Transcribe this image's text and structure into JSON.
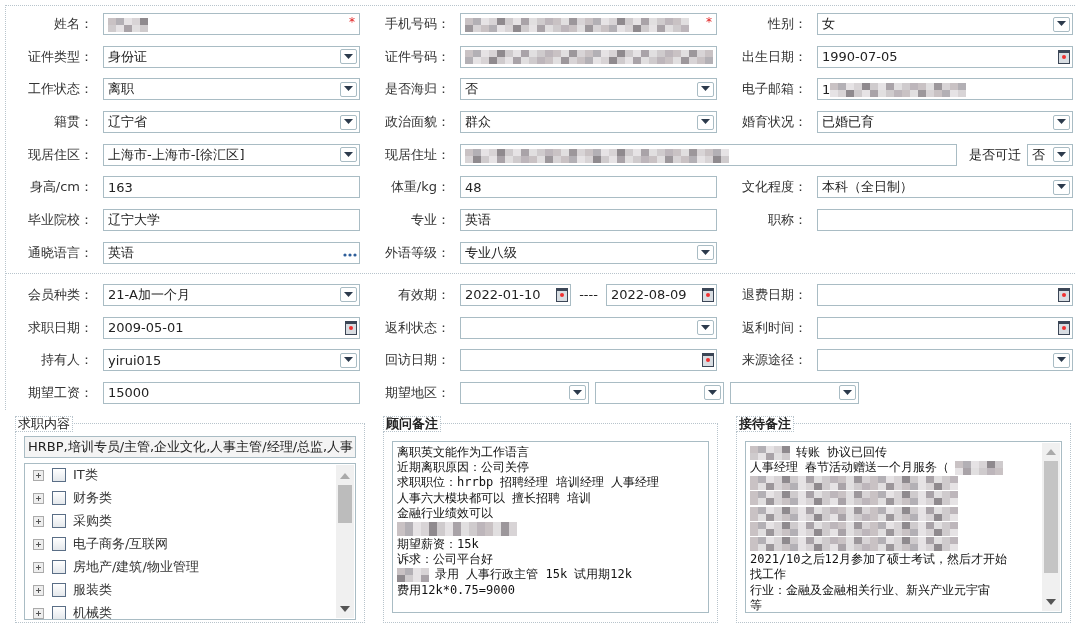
{
  "sections": [
    {
      "rows": [
        [
          {
            "label": "姓名：",
            "parts": [
              {
                "kind": "text",
                "redacted": true,
                "required_mark": "*"
              }
            ]
          },
          {
            "label": "手机号码：",
            "parts": [
              {
                "kind": "text",
                "redacted": true,
                "required_mark": "*"
              }
            ]
          },
          {
            "label": "性别：",
            "parts": [
              {
                "kind": "select",
                "value": "女"
              }
            ]
          }
        ],
        [
          {
            "label": "证件类型：",
            "parts": [
              {
                "kind": "select",
                "value": "身份证"
              }
            ]
          },
          {
            "label": "证件号码：",
            "parts": [
              {
                "kind": "text",
                "redacted": true
              }
            ]
          },
          {
            "label": "出生日期：",
            "parts": [
              {
                "kind": "date",
                "value": "1990-07-05"
              }
            ]
          }
        ],
        [
          {
            "label": "工作状态：",
            "parts": [
              {
                "kind": "select",
                "value": "离职"
              }
            ]
          },
          {
            "label": "是否海归：",
            "parts": [
              {
                "kind": "select",
                "value": "否"
              }
            ]
          },
          {
            "label": "电子邮箱：",
            "parts": [
              {
                "kind": "text",
                "value": "1",
                "redacted": true
              }
            ]
          }
        ],
        [
          {
            "label": "籍贯：",
            "parts": [
              {
                "kind": "select",
                "value": "辽宁省"
              }
            ]
          },
          {
            "label": "政治面貌：",
            "parts": [
              {
                "kind": "select",
                "value": "群众"
              }
            ]
          },
          {
            "label": "婚育状况：",
            "parts": [
              {
                "kind": "select",
                "value": "已婚已育"
              }
            ]
          }
        ],
        [
          {
            "label": "现居住区：",
            "parts": [
              {
                "kind": "select",
                "value": "上海市-上海市-[徐汇区]"
              }
            ]
          },
          {
            "label": "现居住址：",
            "parts": [
              {
                "kind": "text",
                "redacted": true
              },
              {
                "kind": "label",
                "text": "是否可迁"
              },
              {
                "kind": "mini_select",
                "value": "否"
              }
            ]
          }
        ],
        [
          {
            "label": "身高/cm：",
            "parts": [
              {
                "kind": "text",
                "value": "163"
              }
            ]
          },
          {
            "label": "体重/kg：",
            "parts": [
              {
                "kind": "text",
                "value": "48"
              }
            ]
          },
          {
            "label": "文化程度：",
            "parts": [
              {
                "kind": "select",
                "value": "本科（全日制）"
              }
            ]
          }
        ],
        [
          {
            "label": "毕业院校：",
            "parts": [
              {
                "kind": "text",
                "value": "辽宁大学"
              }
            ]
          },
          {
            "label": "专业：",
            "parts": [
              {
                "kind": "text",
                "value": "英语"
              }
            ]
          },
          {
            "label": "职称：",
            "parts": [
              {
                "kind": "text"
              }
            ]
          }
        ],
        [
          {
            "label": "通晓语言：",
            "parts": [
              {
                "kind": "lookup",
                "value": "英语"
              }
            ]
          },
          {
            "label": "外语等级：",
            "parts": [
              {
                "kind": "select",
                "value": "专业八级"
              }
            ]
          },
          null
        ]
      ]
    },
    {
      "rows": [
        [
          {
            "label": "会员种类：",
            "parts": [
              {
                "kind": "select",
                "value": "21-A加一个月"
              }
            ]
          },
          {
            "label": "有效期：",
            "parts": [
              {
                "kind": "date",
                "value": "2022-01-10"
              },
              {
                "kind": "separator",
                "text": "----"
              },
              {
                "kind": "date",
                "value": "2022-08-09"
              }
            ]
          },
          {
            "label": "退费日期：",
            "parts": [
              {
                "kind": "date"
              }
            ]
          }
        ],
        [
          {
            "label": "求职日期：",
            "parts": [
              {
                "kind": "date",
                "value": "2009-05-01"
              }
            ]
          },
          {
            "label": "返利状态：",
            "parts": [
              {
                "kind": "select"
              }
            ]
          },
          {
            "label": "返利时间：",
            "parts": [
              {
                "kind": "date"
              }
            ]
          }
        ],
        [
          {
            "label": "持有人：",
            "parts": [
              {
                "kind": "select",
                "value": "yirui015"
              }
            ]
          },
          {
            "label": "回访日期：",
            "parts": [
              {
                "kind": "date"
              }
            ]
          },
          {
            "label": "来源途径：",
            "parts": [
              {
                "kind": "select"
              }
            ]
          }
        ],
        [
          {
            "label": "期望工资：",
            "parts": [
              {
                "kind": "text",
                "value": "15000"
              }
            ]
          },
          {
            "label": "期望地区：",
            "parts": [
              {
                "kind": "area_select"
              },
              {
                "kind": "area_select"
              },
              {
                "kind": "area_select"
              }
            ]
          }
        ]
      ]
    }
  ],
  "job_intent": {
    "legend": "求职内容",
    "selected_text": "HRBP,培训专员/主管,企业文化,人事主管/经理/总监,人事",
    "tree": [
      {
        "label": "IT类",
        "expanded": false,
        "checked": false
      },
      {
        "label": "财务类",
        "expanded": false,
        "checked": false
      },
      {
        "label": "采购类",
        "expanded": false,
        "checked": false
      },
      {
        "label": "电子商务/互联网",
        "expanded": false,
        "checked": false
      },
      {
        "label": "房地产/建筑/物业管理",
        "expanded": false,
        "checked": false
      },
      {
        "label": "服装类",
        "expanded": false,
        "checked": false
      },
      {
        "label": "机械类",
        "expanded": false,
        "checked": false
      }
    ]
  },
  "advisor_notes": {
    "legend": "顾问备注",
    "lines": [
      {
        "kind": "text",
        "text": "离职英文能作为工作语言"
      },
      {
        "kind": "text",
        "text": "近期离职原因：公司关停"
      },
      {
        "kind": "text",
        "text": "求职职位：hrrbp 招聘经理 培训经理 人事经理"
      },
      {
        "kind": "text",
        "text": "人事六大模块都可以 擅长招聘 培训"
      },
      {
        "kind": "text",
        "text": "金融行业绩效可以"
      },
      {
        "kind": "blurred"
      },
      {
        "kind": "text",
        "text": "期望薪资：15k"
      },
      {
        "kind": "text",
        "text": "诉求：公司平台好"
      },
      {
        "kind": "blurred_lead",
        "text": "录用 人事行政主管 15k 试用期12k"
      },
      {
        "kind": "text",
        "text": "费用12k*0.75=9000"
      }
    ]
  },
  "reception_notes": {
    "legend": "接待备注",
    "lines": [
      {
        "kind": "blurred_lead",
        "text": "转账 协议已回传"
      },
      {
        "kind": "blurred_tail",
        "text": "人事经理  春节活动赠送一个月服务（"
      },
      {
        "kind": "blurred"
      },
      {
        "kind": "blurred"
      },
      {
        "kind": "blurred"
      },
      {
        "kind": "blurred"
      },
      {
        "kind": "blurred"
      },
      {
        "kind": "text",
        "text": "2021/10之后12月参加了硕士考试，然后才开始"
      },
      {
        "kind": "text",
        "text": "找工作"
      },
      {
        "kind": "text",
        "text": "行业：金融及金融相关行业、新兴产业元宇宙"
      },
      {
        "kind": "text",
        "text": "等"
      }
    ]
  }
}
